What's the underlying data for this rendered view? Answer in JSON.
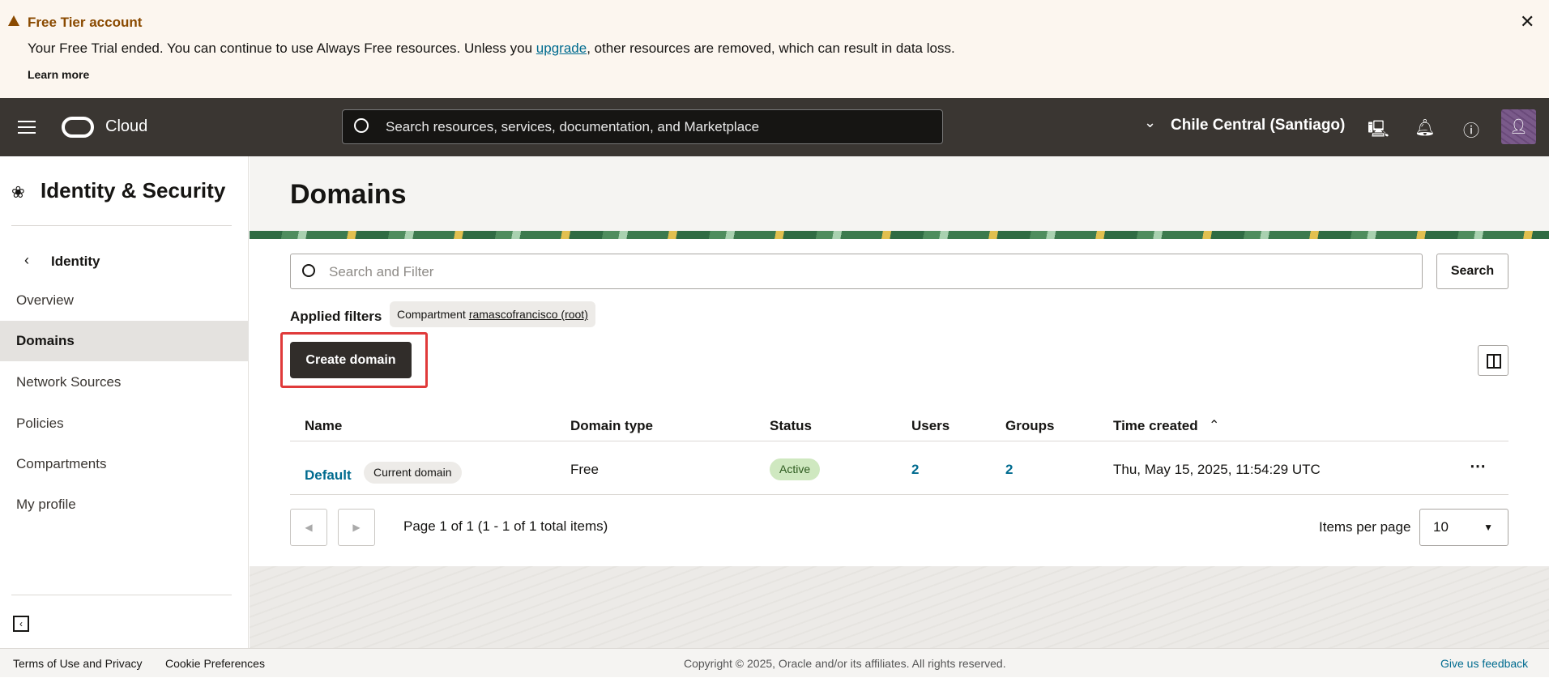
{
  "banner": {
    "title": "Free Tier account",
    "message_pre": "Your Free Trial ended. You can continue to use Always Free resources. Unless you ",
    "message_link": "upgrade",
    "message_post": ", other resources are removed, which can result in data loss.",
    "learn_more": "Learn more",
    "close": "✕"
  },
  "header": {
    "brand": "Cloud",
    "search_placeholder": "Search resources, services, documentation, and Marketplace",
    "region": "Chile Central (Santiago)"
  },
  "sidebar": {
    "title": "Identity & Security",
    "back_label": "Identity",
    "items": [
      {
        "label": "Overview"
      },
      {
        "label": "Domains"
      },
      {
        "label": "Network Sources"
      },
      {
        "label": "Policies"
      },
      {
        "label": "Compartments"
      },
      {
        "label": "My profile"
      }
    ]
  },
  "main": {
    "title": "Domains",
    "search_placeholder": "Search and Filter",
    "search_button": "Search",
    "applied_filters_label": "Applied filters",
    "filter_chip_key": "Compartment",
    "filter_chip_value": "ramascofrancisco (root)",
    "create_button": "Create domain",
    "columns": [
      "Name",
      "Domain type",
      "Status",
      "Users",
      "Groups",
      "Time created"
    ],
    "rows": [
      {
        "name": "Default",
        "tag": "Current domain",
        "type": "Free",
        "status": "Active",
        "users": "2",
        "groups": "2",
        "time": "Thu, May 15, 2025, 11:54:29 UTC"
      }
    ],
    "pagination": {
      "summary": "Page 1 of 1 (1 - 1 of 1 total items)",
      "items_per_page_label": "Items per page",
      "items_per_page": "10"
    }
  },
  "footer": {
    "terms": "Terms of Use and Privacy",
    "cookies": "Cookie Preferences",
    "copyright": "Copyright © 2025, Oracle and/or its affiliates. All rights reserved.",
    "feedback": "Give us feedback"
  },
  "colors": {
    "header_bg": "#3a3632",
    "accent_link": "#006b8f",
    "primary_button": "#312d2a",
    "status_active": "#cfe8c0"
  }
}
